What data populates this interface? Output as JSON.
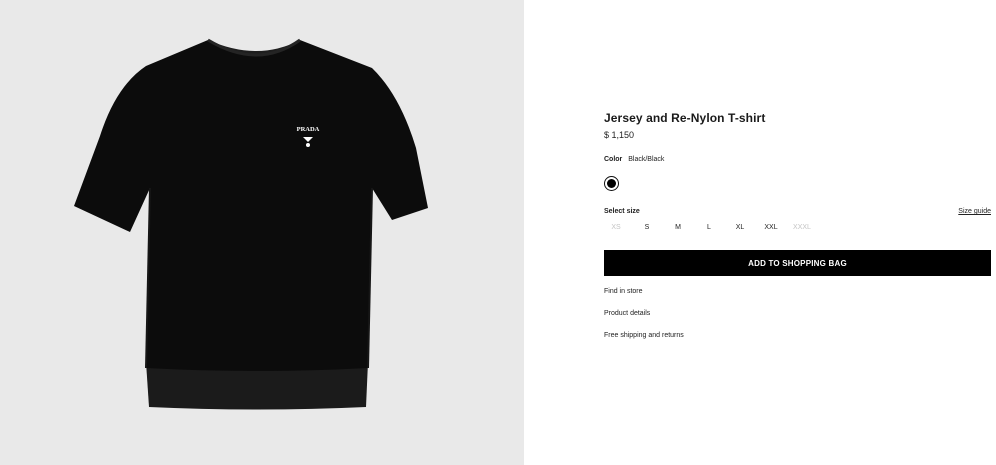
{
  "product": {
    "title": "Jersey and Re-Nylon T-shirt",
    "price": "$ 1,150",
    "image_logo_text": "PRADA"
  },
  "color": {
    "label": "Color",
    "value": "Black/Black",
    "swatch_color": "#000000"
  },
  "size": {
    "label": "Select size",
    "guide_label": "Size guide",
    "options": [
      {
        "label": "XS",
        "available": false
      },
      {
        "label": "S",
        "available": true
      },
      {
        "label": "M",
        "available": true
      },
      {
        "label": "L",
        "available": true
      },
      {
        "label": "XL",
        "available": true
      },
      {
        "label": "XXL",
        "available": true
      },
      {
        "label": "XXXL",
        "available": false
      }
    ]
  },
  "actions": {
    "add_to_bag": "ADD TO SHOPPING BAG"
  },
  "links": {
    "find_in_store": "Find in store",
    "product_details": "Product details",
    "shipping_returns": "Free shipping and returns"
  },
  "colors": {
    "image_background": "#e9e9e9",
    "button_background": "#000000",
    "disabled_size": "#c4c4c4"
  }
}
